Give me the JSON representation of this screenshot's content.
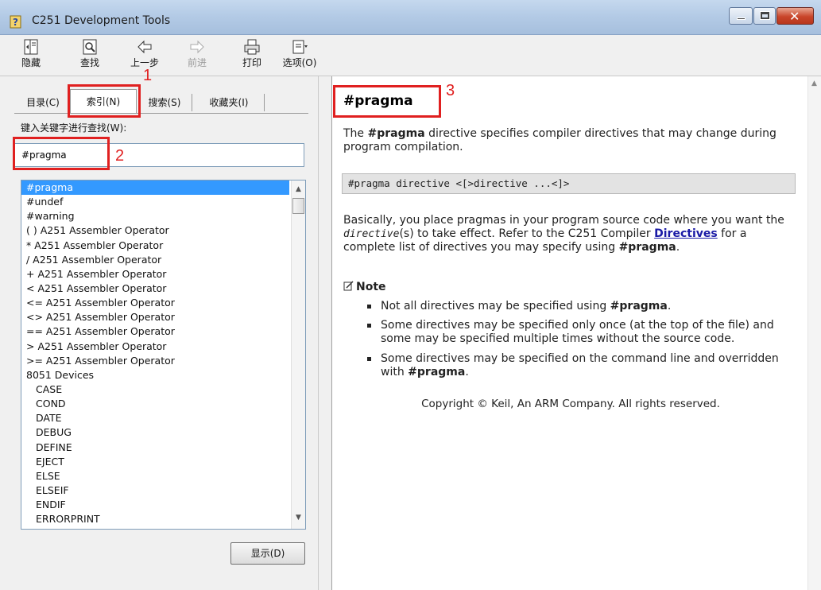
{
  "window": {
    "title": "C251 Development Tools"
  },
  "toolbar": {
    "hide": "隐藏",
    "find": "查找",
    "back": "上一步",
    "forward": "前进",
    "print": "打印",
    "options": "选项(O)"
  },
  "left": {
    "tabs": [
      "目录(C)",
      "索引(N)",
      "搜索(S)",
      "收藏夹(I)"
    ],
    "keyword_label": "键入关键字进行查找(W):",
    "keyword_value": "#pragma",
    "list": [
      "#pragma",
      "#undef",
      "#warning",
      "( ) A251 Assembler Operator",
      "* A251 Assembler Operator",
      "/ A251 Assembler Operator",
      "+ A251 Assembler Operator",
      "< A251 Assembler Operator",
      "<= A251 Assembler Operator",
      "<> A251 Assembler Operator",
      "== A251 Assembler Operator",
      "> A251 Assembler Operator",
      ">= A251 Assembler Operator",
      "8051 Devices",
      "CASE",
      "COND",
      "DATE",
      "DEBUG",
      "DEFINE",
      "EJECT",
      "ELSE",
      "ELSEIF",
      "ENDIF",
      "ERRORPRINT"
    ],
    "show_button": "显示(D)"
  },
  "content": {
    "title": "#pragma",
    "p1_pre": "The ",
    "p1_bold": "#pragma",
    "p1_post": " directive specifies compiler directives that may change during program compilation.",
    "syntax": "#pragma directive <[>directive ...<]>",
    "p2_a": "Basically, you place pragmas in your program source code where you want the ",
    "p2_mono": "directive",
    "p2_b": "(s) to take effect. Refer to the C251 Compiler ",
    "p2_link": "Directives",
    "p2_c": " for a complete list of directives you may specify using ",
    "p2_bold": "#pragma",
    "p2_d": ".",
    "note_label": "Note",
    "note1_pre": "Not all directives may be specified using ",
    "note1_bold": "#pragma",
    "note1_post": ".",
    "note2": "Some directives may be specified only once (at the top of the file) and some may be specified multiple times without the source code.",
    "note3_pre": "Some directives may be specified on the command line and overridden with ",
    "note3_bold": "#pragma",
    "note3_post": ".",
    "copyright": "Copyright © Keil, An ARM Company. All rights reserved."
  },
  "annotations": {
    "n1": "1",
    "n2": "2",
    "n3": "3",
    "color": "#e02020"
  }
}
